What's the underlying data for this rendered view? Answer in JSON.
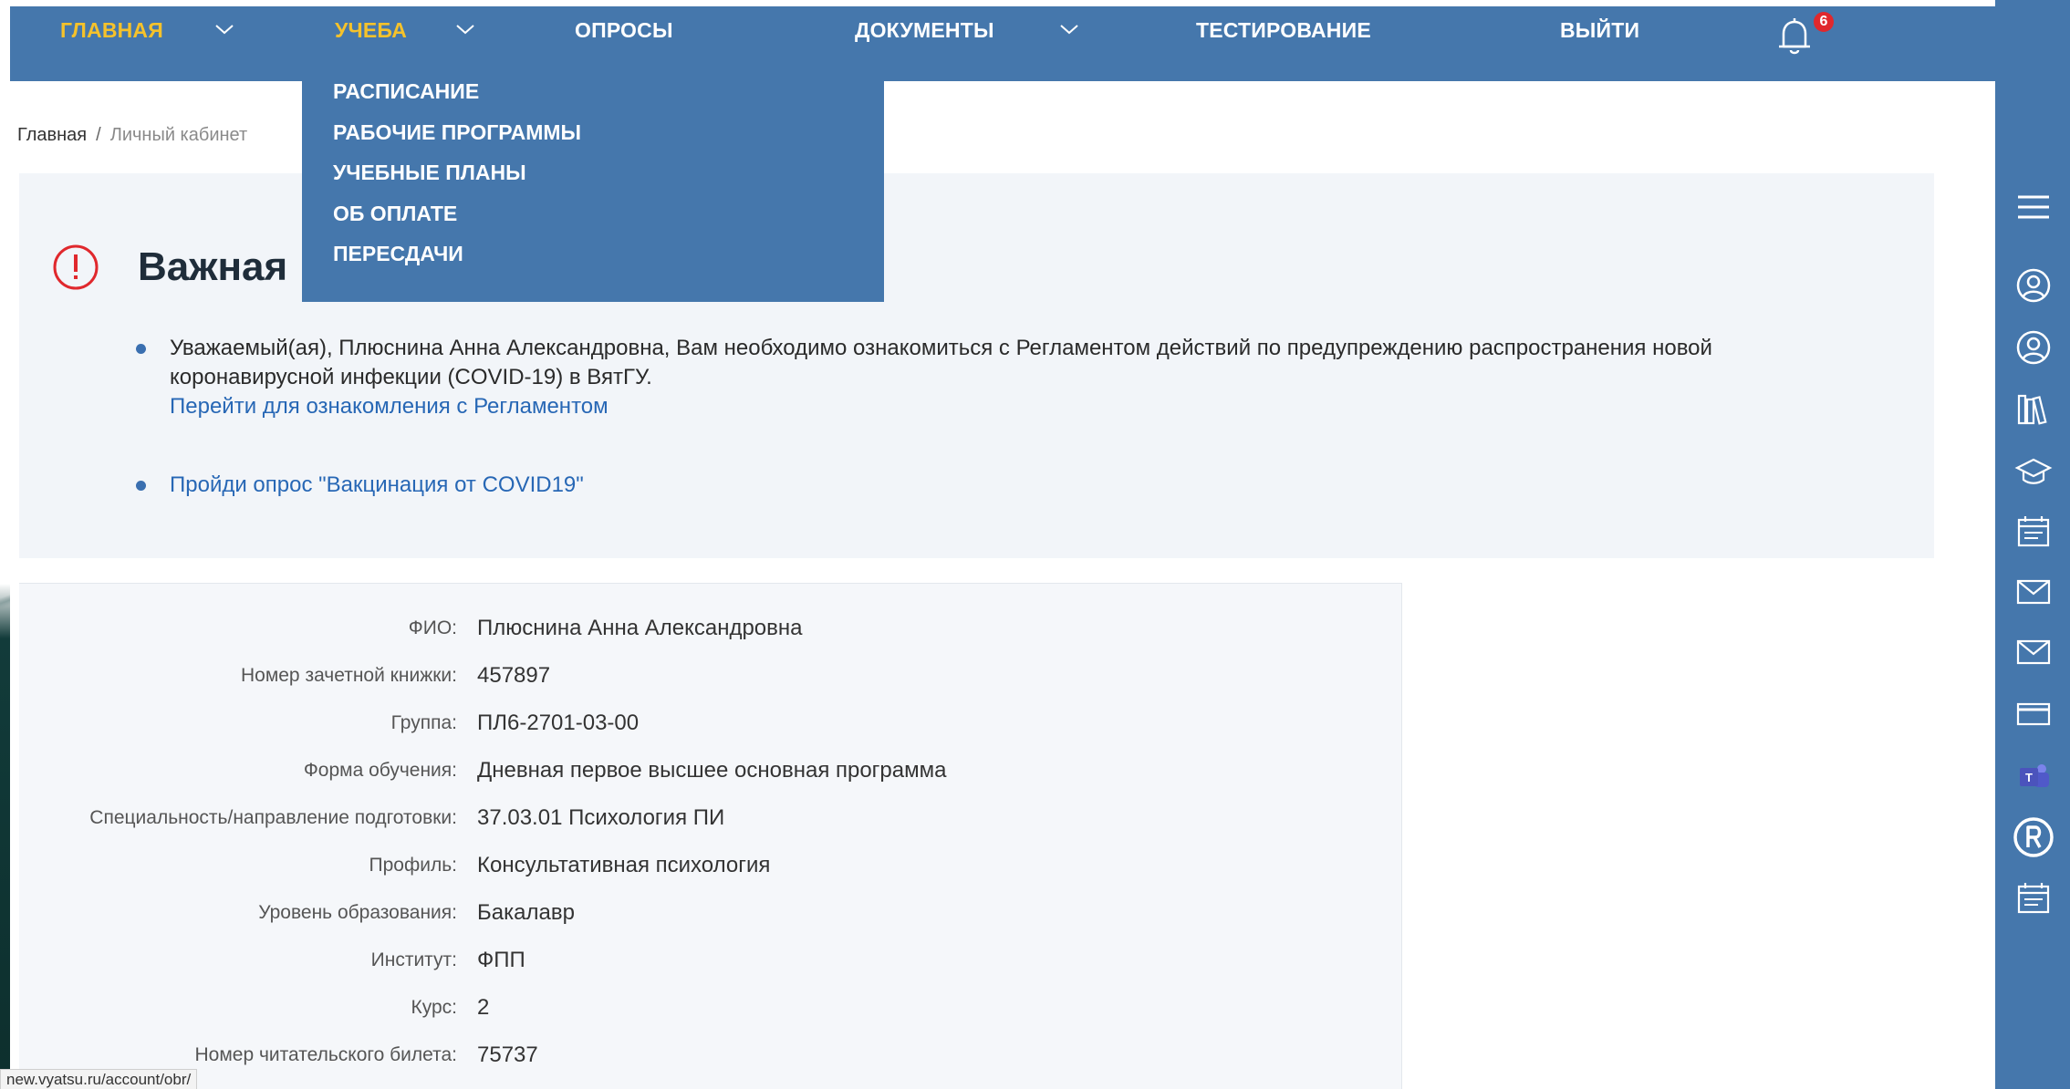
{
  "nav": {
    "items": [
      {
        "label": "ГЛАВНАЯ"
      },
      {
        "label": "УЧЕБА"
      },
      {
        "label": "ОПРОСЫ"
      },
      {
        "label": "ДОКУМЕНТЫ"
      },
      {
        "label": "ТЕСТИРОВАНИЕ"
      },
      {
        "label": "ВЫЙТИ"
      }
    ],
    "notification_count": "6",
    "active_color": "#f5c22b",
    "bar_color": "#4577ac"
  },
  "dropdown": {
    "items": [
      {
        "label": "РАСПИСАНИЕ"
      },
      {
        "label": "РАБОЧИЕ ПРОГРАММЫ"
      },
      {
        "label": "УЧЕБНЫЕ ПЛАНЫ"
      },
      {
        "label": "ОБ ОПЛАТЕ"
      },
      {
        "label": "ПЕРЕСДАЧИ"
      }
    ]
  },
  "breadcrumb": {
    "home": "Главная",
    "separator": "/",
    "current": "Личный кабинет"
  },
  "important": {
    "title_visible": "Важная",
    "message_line1": "Уважаемый(ая), Плюснина Анна Александровна, Вам необходимо ознакомиться с Регламентом действий по предупреждению распространения новой",
    "message_line2": "коронавирусной инфекции (COVID-19) в ВятГУ.",
    "reglament_link": "Перейти для ознакомления с Регламентом",
    "survey_link": "Пройди опрос \"Вакцинация от COVID19\""
  },
  "profile": {
    "rows": [
      {
        "label": "ФИО:",
        "value": "Плюснина Анна Александровна"
      },
      {
        "label": "Номер зачетной книжки:",
        "value": "457897"
      },
      {
        "label": "Группа:",
        "value": "ПЛ6-2701-03-00"
      },
      {
        "label": "Форма обучения:",
        "value": "Дневная первое высшее основная программа"
      },
      {
        "label": "Специальность/направление подготовки:",
        "value": "37.03.01 Психология ПИ"
      },
      {
        "label": "Профиль:",
        "value": "Консультативная психология"
      },
      {
        "label": "Уровень образования:",
        "value": "Бакалавр"
      },
      {
        "label": "Институт:",
        "value": "ФПП"
      },
      {
        "label": "Курс:",
        "value": "2"
      },
      {
        "label": "Номер читательского билета:",
        "value": "75737"
      }
    ]
  },
  "sidebar": {
    "icons": [
      "menu-icon",
      "user-circle-icon",
      "user-circle-icon",
      "library-books-icon",
      "graduation-cap-icon",
      "calendar-icon",
      "mail-icon",
      "mail-icon",
      "card-icon",
      "teams-icon",
      "r-circle-icon",
      "calendar-icon"
    ]
  },
  "statusbar": {
    "url": "new.vyatsu.ru/account/obr/"
  }
}
